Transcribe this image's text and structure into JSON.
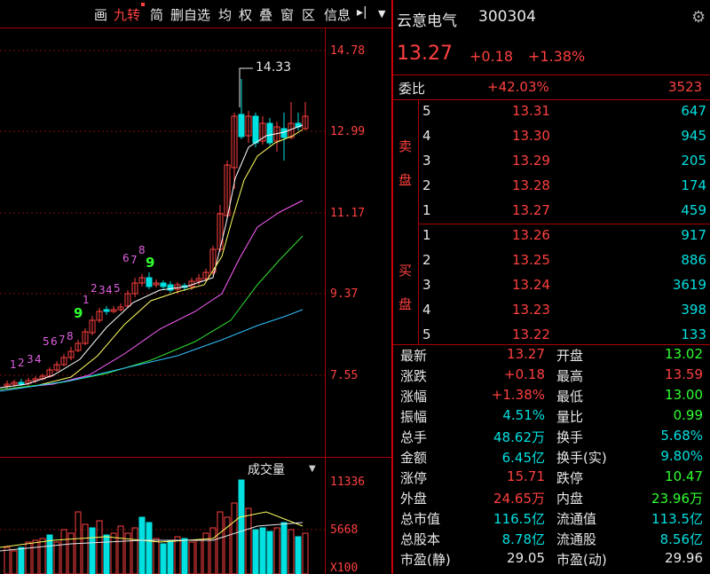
{
  "toolbar": {
    "items": [
      "画",
      "九转",
      "简",
      "删自选",
      "均",
      "权",
      "叠",
      "窗",
      "区",
      "信息"
    ],
    "arrow": "▸|"
  },
  "price_axis": [
    "14.78",
    "12.99",
    "11.17",
    "9.37",
    "7.55"
  ],
  "annotation_high": "14.33",
  "nine_turn": {
    "low_seq": [
      "1",
      "2",
      "3",
      "4"
    ],
    "low_seq2": [
      "5",
      "6",
      "7",
      "8"
    ],
    "nine_low": "9",
    "mid_seq": [
      "1",
      "2",
      "3",
      "4",
      "5"
    ],
    "high_seq": [
      "6",
      "7",
      "8"
    ],
    "nine_high": "9"
  },
  "volume": {
    "label": "成交量",
    "axis": [
      "11336",
      "5668",
      "X100"
    ]
  },
  "quote": {
    "name": "云意电气",
    "code": "300304",
    "price": "13.27",
    "change": "+0.18",
    "change_pct": "+1.38%",
    "weibi_label": "委比",
    "weibi_value": "+42.03%",
    "weibi_diff": "3523",
    "sell_label": [
      "卖",
      "盘"
    ],
    "buy_label": [
      "买",
      "盘"
    ],
    "sell": [
      {
        "lvl": "5",
        "price": "13.31",
        "vol": "647"
      },
      {
        "lvl": "4",
        "price": "13.30",
        "vol": "945"
      },
      {
        "lvl": "3",
        "price": "13.29",
        "vol": "205"
      },
      {
        "lvl": "2",
        "price": "13.28",
        "vol": "174"
      },
      {
        "lvl": "1",
        "price": "13.27",
        "vol": "459"
      }
    ],
    "buy": [
      {
        "lvl": "1",
        "price": "13.26",
        "vol": "917"
      },
      {
        "lvl": "2",
        "price": "13.25",
        "vol": "886"
      },
      {
        "lvl": "3",
        "price": "13.24",
        "vol": "3619"
      },
      {
        "lvl": "4",
        "price": "13.23",
        "vol": "398"
      },
      {
        "lvl": "5",
        "price": "13.22",
        "vol": "133"
      }
    ],
    "stats": [
      {
        "l1": "最新",
        "v1": "13.27",
        "c1": "red",
        "l2": "开盘",
        "v2": "13.02",
        "c2": "green"
      },
      {
        "l1": "涨跌",
        "v1": "+0.18",
        "c1": "red",
        "l2": "最高",
        "v2": "13.59",
        "c2": "red"
      },
      {
        "l1": "涨幅",
        "v1": "+1.38%",
        "c1": "red",
        "l2": "最低",
        "v2": "13.00",
        "c2": "green"
      },
      {
        "l1": "振幅",
        "v1": "4.51%",
        "c1": "cyan",
        "l2": "量比",
        "v2": "0.99",
        "c2": "green"
      },
      {
        "l1": "总手",
        "v1": "48.62万",
        "c1": "cyan",
        "l2": "换手",
        "v2": "5.68%",
        "c2": "cyan"
      },
      {
        "l1": "金额",
        "v1": "6.45亿",
        "c1": "cyan",
        "l2": "换手(实)",
        "v2": "9.80%",
        "c2": "cyan"
      },
      {
        "l1": "涨停",
        "v1": "15.71",
        "c1": "red",
        "l2": "跌停",
        "v2": "10.47",
        "c2": "green"
      },
      {
        "l1": "外盘",
        "v1": "24.65万",
        "c1": "red",
        "l2": "内盘",
        "v2": "23.96万",
        "c2": "green"
      },
      {
        "l1": "总市值",
        "v1": "116.5亿",
        "c1": "cyan",
        "l2": "流通值",
        "v2": "113.5亿",
        "c2": "cyan"
      },
      {
        "l1": "总股本",
        "v1": "8.78亿",
        "c1": "cyan",
        "l2": "流通股",
        "v2": "8.56亿",
        "c2": "cyan"
      },
      {
        "l1": "市盈(静)",
        "v1": "29.05",
        "c1": "white",
        "l2": "市盈(动)",
        "v2": "29.96",
        "c2": "white"
      }
    ]
  },
  "colors": {
    "up": "#ff4040",
    "down": "#00e0e0",
    "ma5": "#ffffff",
    "ma10": "#ffff60",
    "ma20": "#ff60ff",
    "ma30": "#30e030",
    "ma60": "#30c0ff"
  }
}
